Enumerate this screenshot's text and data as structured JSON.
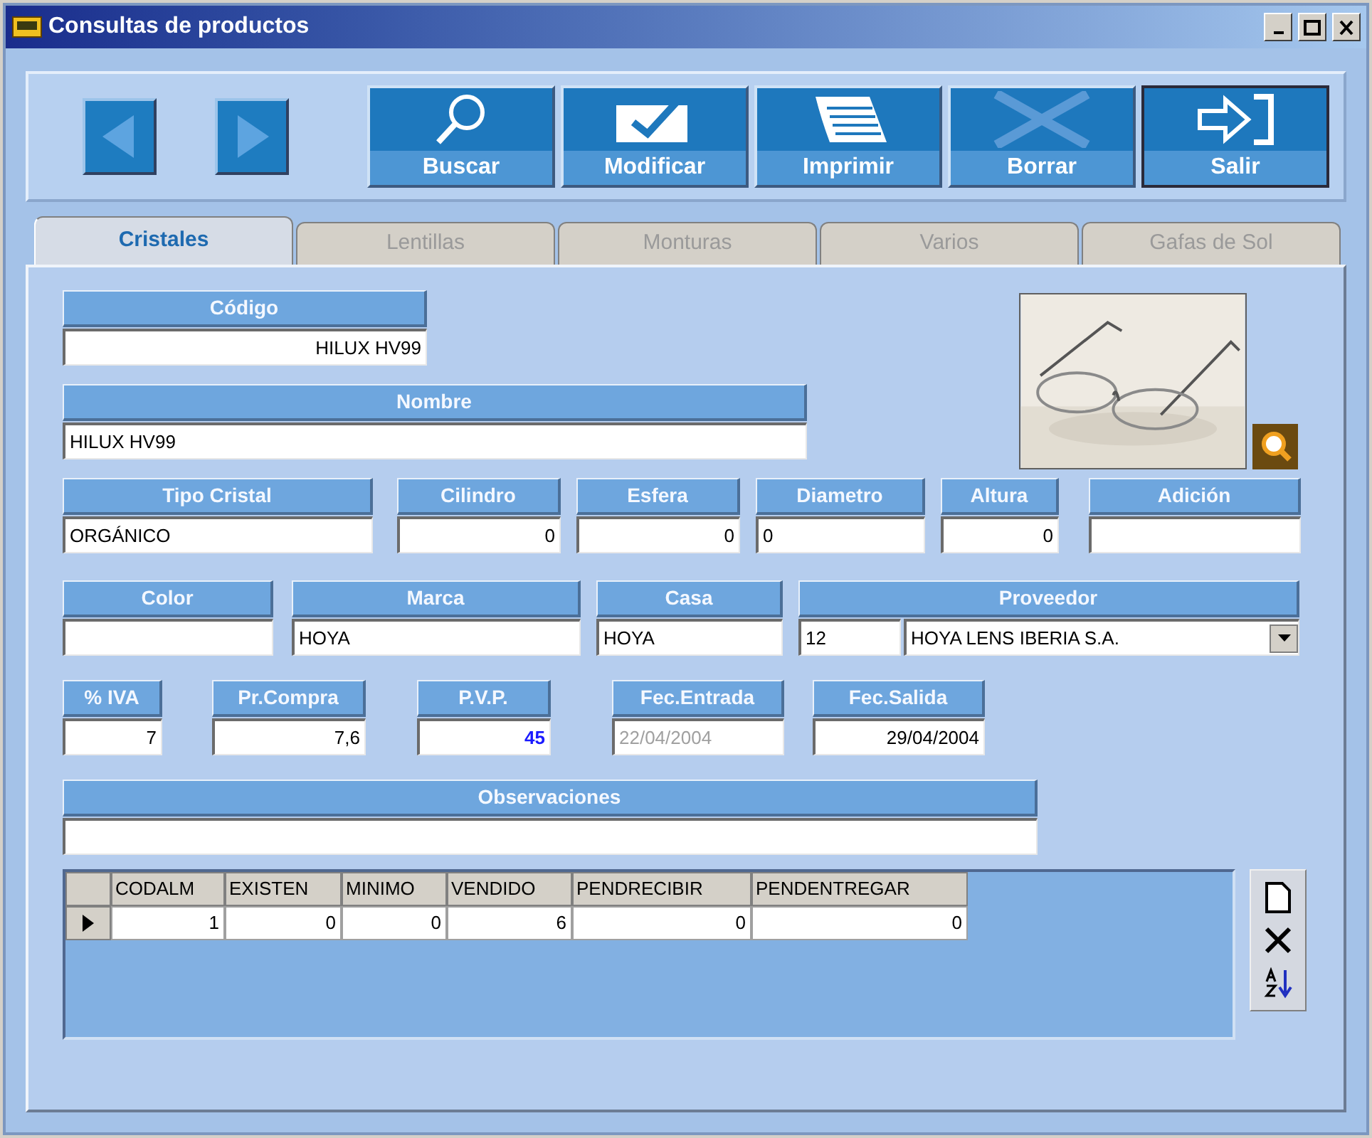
{
  "window": {
    "title": "Consultas de productos"
  },
  "toolbar": {
    "buttons": [
      {
        "label": "Buscar",
        "kind": "search",
        "disabled": false,
        "focused": false
      },
      {
        "label": "Modificar",
        "kind": "modify",
        "disabled": false,
        "focused": false
      },
      {
        "label": "Imprimir",
        "kind": "print",
        "disabled": false,
        "focused": false
      },
      {
        "label": "Borrar",
        "kind": "delete",
        "disabled": true,
        "focused": false
      },
      {
        "label": "Salir",
        "kind": "exit",
        "disabled": false,
        "focused": true
      }
    ]
  },
  "tabs": [
    {
      "label": "Cristales",
      "selected": true
    },
    {
      "label": "Lentillas",
      "selected": false
    },
    {
      "label": "Monturas",
      "selected": false
    },
    {
      "label": "Varios",
      "selected": false
    },
    {
      "label": "Gafas de Sol",
      "selected": false
    }
  ],
  "form": {
    "fields": [
      {
        "label": "Código",
        "value": "HILUX HV99",
        "kind": "number"
      },
      {
        "label": "Nombre",
        "value": "HILUX HV99",
        "kind": "text"
      },
      {
        "label": "Tipo Cristal",
        "value": "ORGÁNICO",
        "kind": "text"
      },
      {
        "label": "Cilindro",
        "value": "0",
        "kind": "number"
      },
      {
        "label": "Esfera",
        "value": "0",
        "kind": "number"
      },
      {
        "label": "Diametro",
        "value": "0",
        "kind": "text"
      },
      {
        "label": "Altura",
        "value": "0",
        "kind": "number"
      },
      {
        "label": "Adición",
        "kind": "text"
      },
      {
        "label": "Color",
        "kind": "text"
      },
      {
        "label": "Marca",
        "value": "HOYA",
        "kind": "text"
      },
      {
        "label": "Casa",
        "value": "HOYA",
        "kind": "text"
      },
      {
        "label": "Proveedor",
        "value": "12",
        "combo_value": "HOYA LENS IBERIA S.A.",
        "kind": "combo"
      },
      {
        "label": "% IVA",
        "value": "7",
        "kind": "number"
      },
      {
        "label": "Pr.Compra",
        "value": "7,6",
        "kind": "number"
      },
      {
        "label": "P.V.P.",
        "value": "45",
        "kind": "price"
      },
      {
        "label": "Fec.Entrada",
        "value": "22/04/2004",
        "kind": "readonly"
      },
      {
        "label": "Fec.Salida",
        "value": "29/04/2004",
        "kind": "number"
      },
      {
        "label": "Observaciones",
        "kind": "text"
      }
    ]
  },
  "table": {
    "columns": [
      "CODALM",
      "EXISTEN",
      "MINIMO",
      "VENDIDO",
      "PENDRECIBIR",
      "PENDENTREGAR"
    ],
    "rows": [
      {
        "selected": true,
        "cells": [
          "1",
          "0",
          "0",
          "6",
          "0",
          "0"
        ]
      }
    ]
  }
}
